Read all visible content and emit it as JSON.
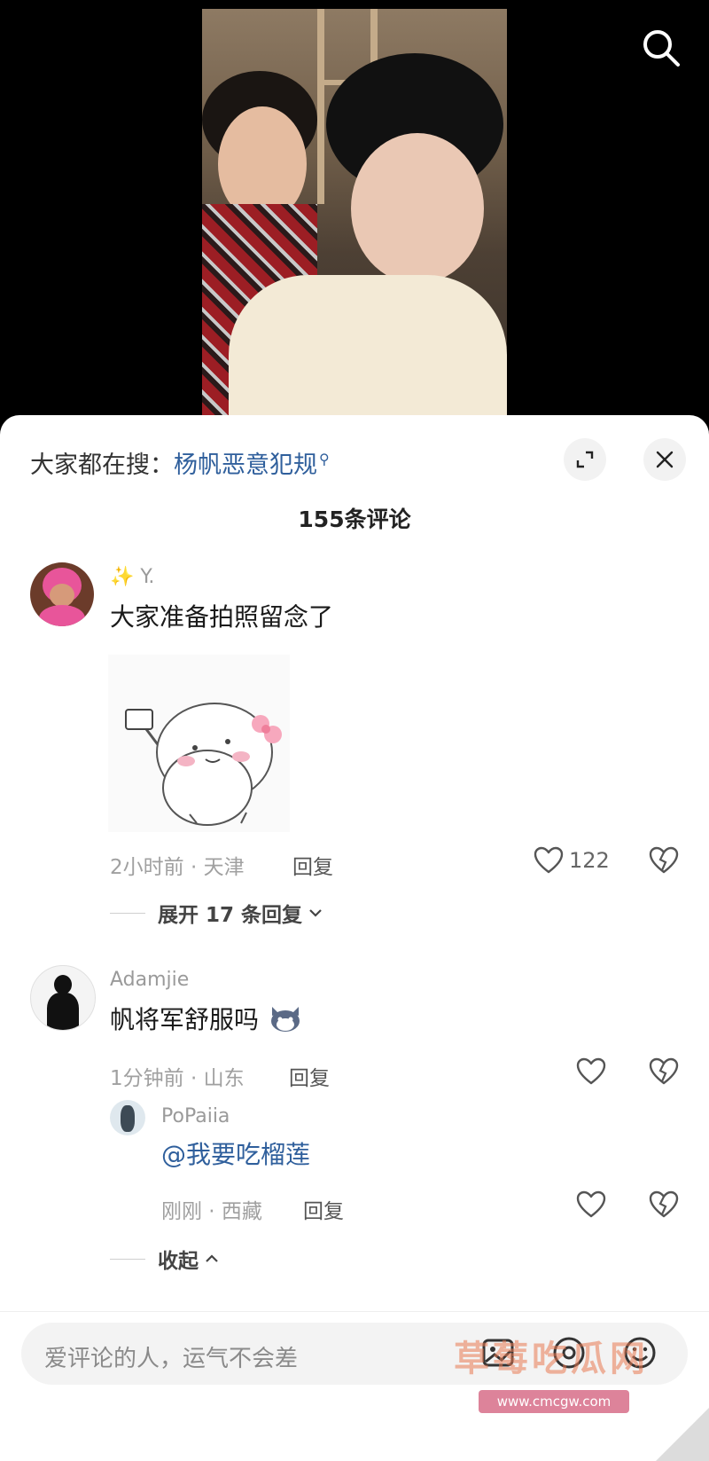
{
  "header": {
    "hot_search_prefix": "大家都在搜：",
    "hot_search_keyword": "杨帆恶意犯规"
  },
  "comment_count": "155条评论",
  "comments": [
    {
      "username": "✨ Y.",
      "text": "大家准备拍照留念了",
      "meta": "2小时前 · 天津",
      "reply_label": "回复",
      "like_count": "122",
      "expand_label": "展开 17 条回复"
    },
    {
      "username": "Adamjie",
      "text": "帆将军舒服吗",
      "meta": "1分钟前 · 山东",
      "reply_label": "回复",
      "replies": [
        {
          "username": "PoPaiia",
          "text": "@我要吃榴莲",
          "meta": "刚刚 · 西藏",
          "reply_label": "回复"
        }
      ],
      "collapse_label": "收起"
    }
  ],
  "input": {
    "placeholder": "爱评论的人，运气不会差"
  },
  "watermark": {
    "text": "草莓吃瓜网",
    "url": "www.cmcgw.com"
  },
  "colors": {
    "keyword_blue": "#2f5f9c",
    "sheet_background": "#ffffff",
    "video_background": "#000000"
  }
}
